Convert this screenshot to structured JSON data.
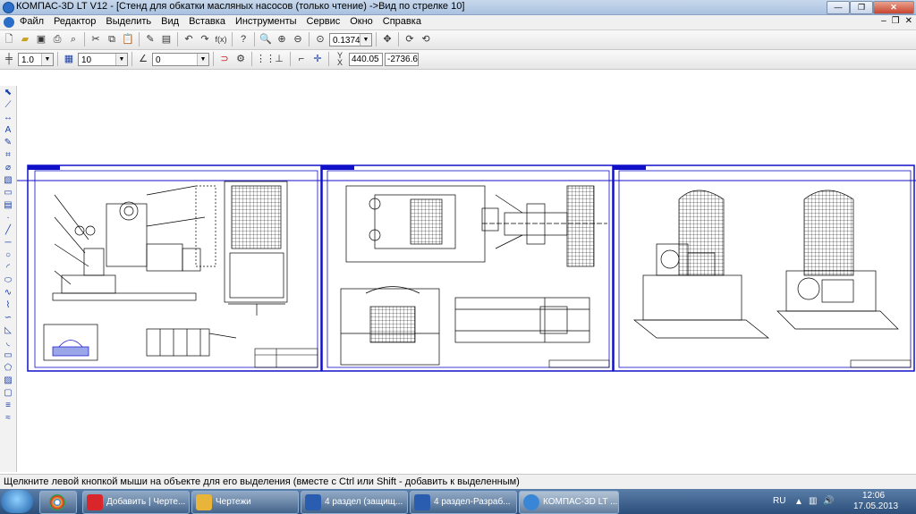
{
  "window": {
    "title": "КОМПАС-3D LT V12 - [Стенд для обкатки масляных насосов  (только чтение) ->Вид по стрелке 10]"
  },
  "menu": [
    "Файл",
    "Редактор",
    "Выделить",
    "Вид",
    "Вставка",
    "Инструменты",
    "Сервис",
    "Окно",
    "Справка"
  ],
  "toolbar1": {
    "zoom_value": "0.1374"
  },
  "toolbar2": {
    "line_scale": "1.0",
    "layer_value": "10",
    "angle_value": "0",
    "coord_x_label": "Y",
    "coord_y_label": "X",
    "coord_x": "440.05",
    "coord_y": "-2736.6"
  },
  "status": {
    "text": "Щелкните левой кнопкой мыши на объекте для его выделения (вместе с Ctrl или Shift - добавить к выделенным)"
  },
  "taskbar": {
    "buttons": [
      {
        "label": "Добавить | Черте...",
        "color": "#d8262b"
      },
      {
        "label": "Чертежи",
        "color": "#e8b43a"
      },
      {
        "label": "4 раздел (защищ...",
        "color": "#2a5db0"
      },
      {
        "label": "4 раздел-Разраб...",
        "color": "#2a5db0"
      },
      {
        "label": "КОМПАС-3D LT ...",
        "color": "#3a86d6"
      }
    ],
    "lang": "RU",
    "time": "12:06",
    "date": "17.05.2013"
  },
  "colors": {
    "frame": "#1010c8",
    "title_bg": "#a9c2e0",
    "taskbar": "#2b4f7a"
  }
}
